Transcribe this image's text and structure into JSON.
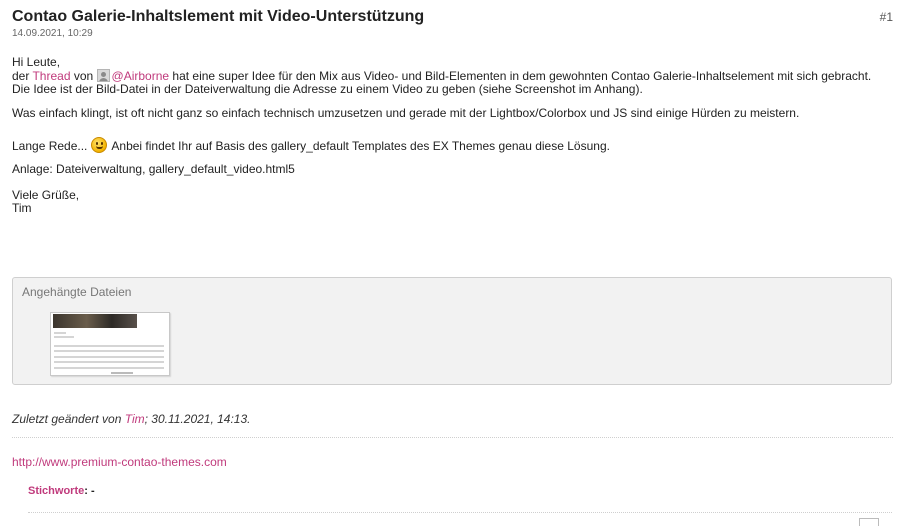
{
  "post": {
    "title": "Contao Galerie-Inhaltslement mit Video-Unterstützung",
    "date": "14.09.2021, 10:29",
    "number": "#1"
  },
  "body": {
    "greeting": "Hi Leute,",
    "line1_prefix": "der ",
    "line1_thread_link": "Thread",
    "line1_von": " von ",
    "line1_user_link": "@Airborne",
    "line1_rest": " hat eine super Idee für den Mix aus Video- und Bild-Elementen in dem gewohnten Contao Galerie-Inhaltselement mit sich gebracht.",
    "line2": "Die Idee ist der Bild-Datei in der Dateiverwaltung die Adresse zu einem Video zu geben (siehe Screenshot im Anhang).",
    "para2": "Was einfach klingt, ist oft nicht ganz so einfach technisch umzusetzen und gerade mit der Lightbox/Colorbox und JS sind einige Hürden zu meistern.",
    "para3_prefix": "Lange Rede... ",
    "para3_rest": " Anbei findet Ihr auf Basis des gallery_default Templates des EX Themes genau diese Lösung.",
    "para4": "Anlage: Dateiverwaltung, gallery_default_video.html5",
    "closing": "Viele Grüße,",
    "signature_name": "Tim"
  },
  "attachments": {
    "title": "Angehängte Dateien"
  },
  "edited": {
    "prefix": "Zuletzt geändert von ",
    "user": "Tim",
    "suffix": "; 30.11.2021, 14:13."
  },
  "signature": {
    "url": "http://www.premium-contao-themes.com"
  },
  "tags": {
    "label": "Stichworte",
    "colon": ":",
    "value": " -"
  },
  "icons": {
    "user_avatar": "user-avatar-icon",
    "smiley": "smiley-icon"
  },
  "colors": {
    "link": "#c03a7c",
    "attachment_bg": "#f2f2f2"
  }
}
